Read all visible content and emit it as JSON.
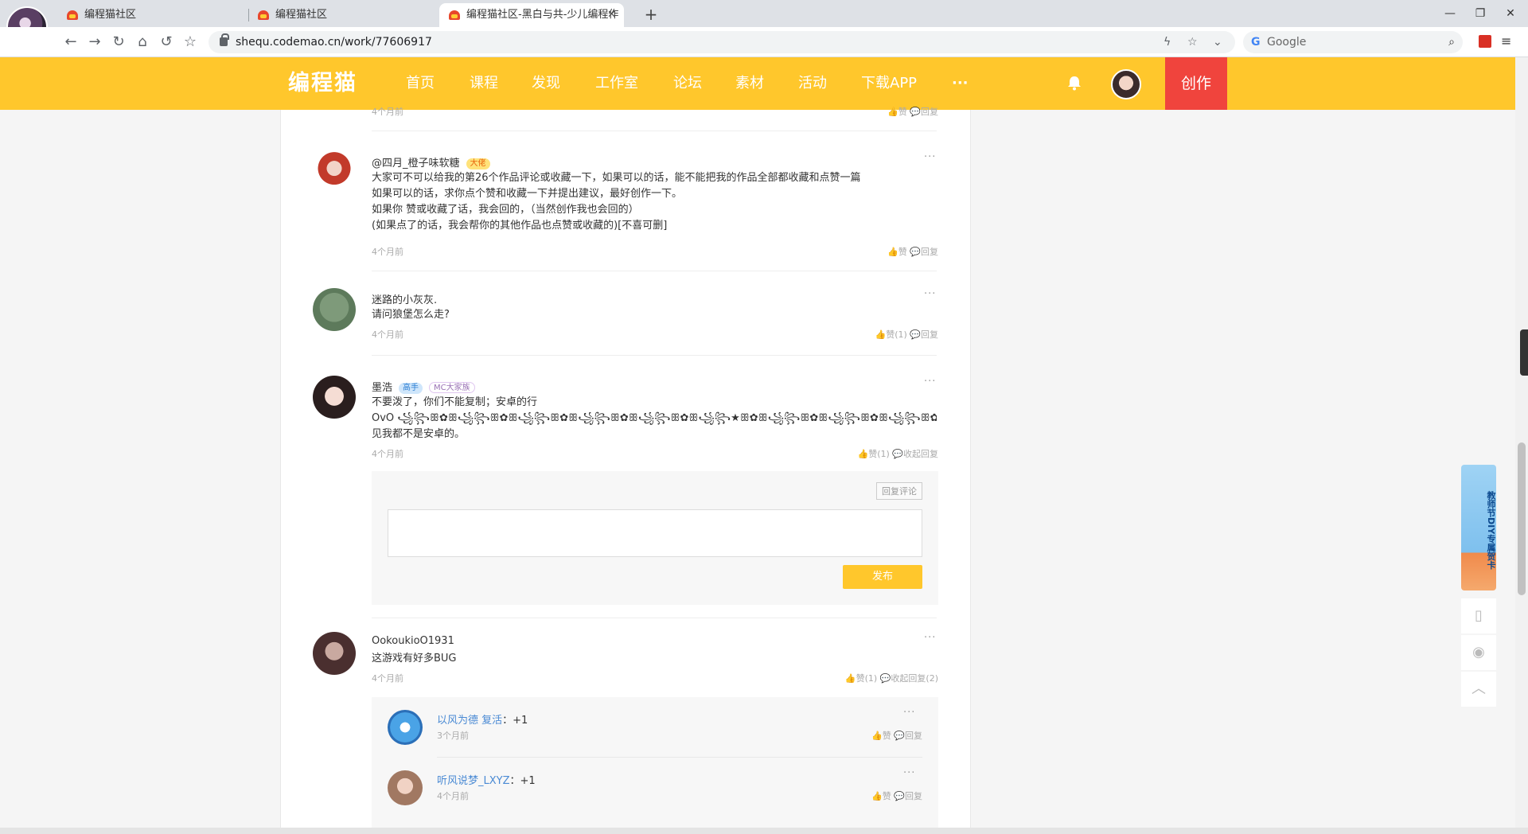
{
  "browser": {
    "tabs": [
      {
        "title": "编程猫社区"
      },
      {
        "title": "编程猫社区"
      },
      {
        "title": "编程猫社区-黑白与共-少儿编程作"
      }
    ],
    "url": "shequ.codemao.cn/work/77606917",
    "search_placeholder": "Google"
  },
  "site": {
    "logo": "编程猫",
    "nav": [
      "首页",
      "课程",
      "发现",
      "工作室",
      "论坛",
      "素材",
      "活动",
      "下载APP",
      "···"
    ],
    "create_label": "创作",
    "brand_color": "#ffc72c",
    "create_color": "#f0443d"
  },
  "comments": [
    {
      "time": "4个月前",
      "like_label": "赞",
      "reply_label": "回复"
    },
    {
      "name": "@四月_橙子味软糖",
      "badge": "大佬",
      "lines": [
        "大家可不可以给我的第26个作品评论或收藏一下，如果可以的话，能不能把我的作品全部都收藏和点赞一篇",
        "如果可以的话，求你点个赞和收藏一下并提出建议，最好创作一下。",
        "如果你 赞或收藏了话，我会回的，（当然创作我也会回的）",
        "(如果点了的话，我会帮你的其他作品也点赞或收藏的)[不喜可删]"
      ],
      "time": "4个月前",
      "like_label": "赞",
      "reply_label": "回复"
    },
    {
      "name": "迷路的小灰灰.",
      "lines": [
        "请问狼堡怎么走?"
      ],
      "time": "4个月前",
      "like_label": "赞(1)",
      "reply_label": "回复"
    },
    {
      "name": "墨浩",
      "badge": "高手",
      "badge2": "MC大家族",
      "lines": [
        "不要泼了，你们不能复制；安卓的行",
        "OvO ꧁꧂ꕥ✿ꕥ꧁꧂ꕥ✿ꕥ꧁꧂ꕥ✿ꕥ꧁꧂ꕥ✿ꕥ꧁꧂ꕥ✿ꕥ꧁꧂★ꕥ✿ꕥ꧁꧂ꕥ✿ꕥ꧁꧂ꕥ✿ꕥ꧁꧂ꕥ✿ꕥ o 我还喵呢！我信他个鬼，",
        "见我都不是安卓的。"
      ],
      "time": "4个月前",
      "like_label": "赞(1)",
      "reply_label": "收起回复",
      "reply_box": {
        "tag": "回复评论",
        "publish": "发布"
      }
    },
    {
      "name": "OokoukioO1931",
      "lines": [
        "这游戏有好多BUG"
      ],
      "time": "4个月前",
      "like_label": "赞(1)",
      "reply_label": "收起回复(2)",
      "replies": [
        {
          "name": "以风为德 复活",
          "text": "+1",
          "time": "3个月前",
          "like_label": "赞",
          "reply_label": "回复"
        },
        {
          "name": "听风说梦_LXYZ",
          "text": "+1",
          "time": "4个月前",
          "like_label": "赞",
          "reply_label": "回复"
        }
      ]
    }
  ],
  "promo": {
    "text": "教师节DIY专属贺卡"
  },
  "float_icons": [
    "tablet-icon",
    "qq-icon",
    "back-to-top-icon"
  ]
}
